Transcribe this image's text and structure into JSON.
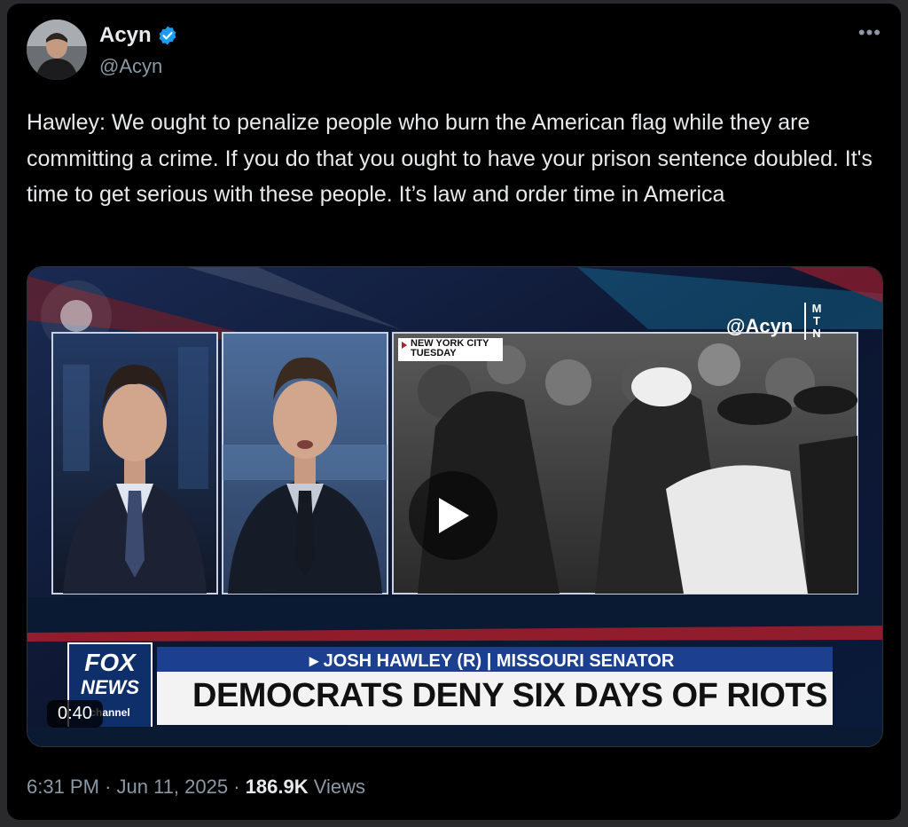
{
  "author": {
    "name": "Acyn",
    "handle": "@Acyn",
    "verified": true,
    "verified_color": "#1d9bf0"
  },
  "more_label": "•••",
  "tweet_text": "Hawley: We ought to penalize people who burn the American flag while they are committing a crime. If you do that you ought to have your prison sentence doubled. It's time to get serious with these people. It’s law and order time in America",
  "video": {
    "duration": "0:40",
    "watermark": "@Acyn",
    "mtn_logo": [
      "M",
      "T",
      "N"
    ],
    "location_tag": "NEW YORK CITY",
    "day_tag": "TUESDAY",
    "lower_third_name": "JOSH HAWLEY (R)",
    "lower_third_title": "MISSOURI SENATOR",
    "headline": "DEMOCRATS DENY SIX DAYS OF RIOTS",
    "channel_logo_top": "FOX",
    "channel_logo_bottom": "NEWS",
    "channel_logo_sub": "channel"
  },
  "meta": {
    "time": "6:31 PM",
    "date": "Jun 11, 2025",
    "views_count": "186.9K",
    "views_label": "Views",
    "separator": "·"
  }
}
